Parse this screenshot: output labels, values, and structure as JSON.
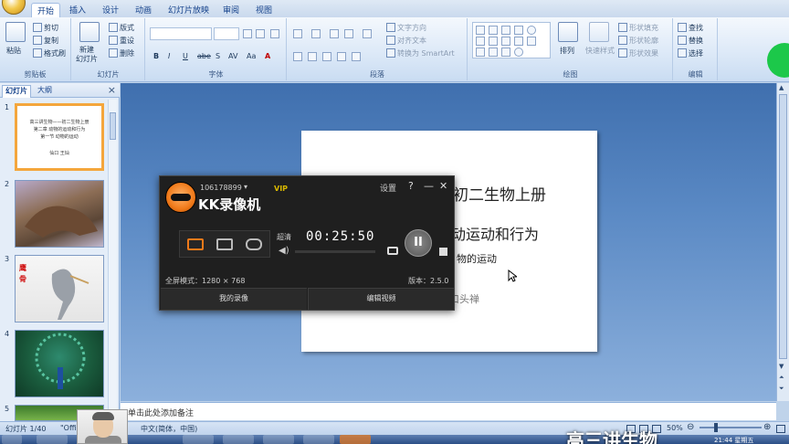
{
  "ribbon": {
    "tabs": [
      "开始",
      "插入",
      "设计",
      "动画",
      "幻灯片放映",
      "审阅",
      "视图"
    ],
    "active_tab": "开始",
    "clipboard": {
      "paste": "粘贴",
      "cut": "剪切",
      "copy": "复制",
      "format_painter": "格式刷",
      "label": "剪贴板"
    },
    "slides": {
      "new_slide": "新建\n幻灯片",
      "layout": "版式",
      "reset": "重设",
      "delete": "删除",
      "label": "幻灯片"
    },
    "font": {
      "label": "字体",
      "bold": "B",
      "italic": "I",
      "underline": "U",
      "strike": "abe",
      "shadow": "S",
      "spacing": "AV",
      "case": "Aa",
      "color": "A"
    },
    "paragraph": {
      "text_direction": "文字方向",
      "align_text": "对齐文本",
      "smartart": "转换为 SmartArt",
      "label": "段落"
    },
    "drawing": {
      "arrange": "排列",
      "quick_styles": "快速样式",
      "shape_fill": "形状填充",
      "shape_outline": "形状轮廓",
      "shape_effects": "形状效果",
      "label": "绘图"
    },
    "editing": {
      "find": "查找",
      "replace": "替换",
      "select": "选择",
      "label": "编辑"
    }
  },
  "left_pane": {
    "tabs": [
      "幻灯片",
      "大纲"
    ],
    "close": "×",
    "slide1": {
      "title": "高三讲生物——初二生物上册",
      "line2": "第二章 动物的运动和行为",
      "line3": "第一节 动物的运动",
      "author": "仙口 王灿"
    },
    "slide_numbers": [
      "1",
      "2",
      "3",
      "4",
      "5"
    ],
    "slide3_label": "鹰骨"
  },
  "slide": {
    "line1": "初二生物上册",
    "line2": "动运动和行为",
    "line3": "物的运动",
    "line4": "口头禅"
  },
  "notes": {
    "placeholder": "单击此处添加备注"
  },
  "status": {
    "slide_count": "幻灯片 1/40",
    "theme": "\"Offi",
    "language": "中文(简体，中国)",
    "zoom": "50%"
  },
  "recorder": {
    "user_id": "106178899",
    "vip": "VIP",
    "app_name": "KK录像机",
    "settings": "设置",
    "help": "?",
    "minimize": "—",
    "close": "✕",
    "quality": "超清",
    "timer": "00:25:50",
    "fullscreen_mode": "全屏模式：1280 × 768",
    "version": "版本：2.5.0",
    "my_recordings": "我的录像",
    "edit_video": "编辑视频"
  },
  "overlay": {
    "caption": "高三讲生物"
  },
  "taskbar": {
    "time": "21:44 星期五"
  },
  "colors": {
    "accent": "#f07a1a",
    "ribbon": "#dbe8f7",
    "workspace": "#5a89c4"
  }
}
